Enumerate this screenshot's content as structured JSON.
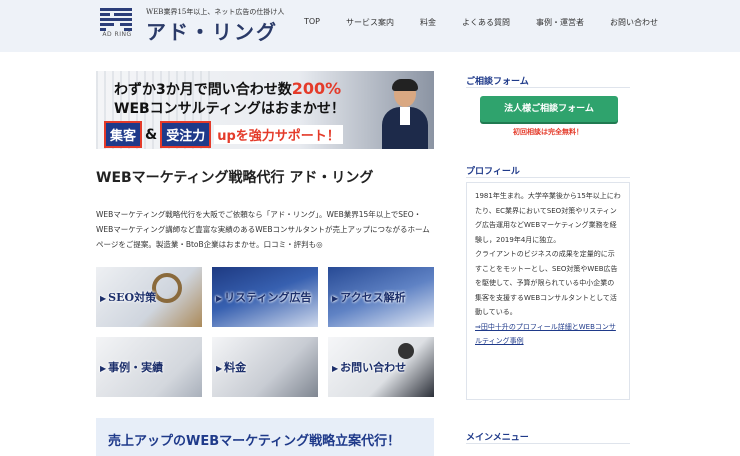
{
  "header": {
    "logo_caption": "AD RING",
    "tagline": "WEB業界15年以上、ネット広告の仕掛け人",
    "brand": "アド・リング",
    "nav": [
      "TOP",
      "サービス案内",
      "料金",
      "よくある質問",
      "事例・運営者",
      "お問い合わせ"
    ]
  },
  "hero": {
    "line1_pre": "わずか3か月で問い合わせ数",
    "line1_highlight": "200%",
    "line2": "WEBコンサルティングはおまかせ！",
    "tag1": "集客",
    "amp": "&",
    "tag2": "受注力",
    "tail": "upを強力サポート！"
  },
  "main": {
    "title": "WEBマーケティング戦略代行 アド・リング",
    "intro": "WEBマーケティング戦略代行を大阪でご依頼なら「アド・リング」。WEB業界15年以上でSEO・WEBマーケティング講師など豊富な実績のあるWEBコンサルタントが売上アップにつながるホームページをご提案。製造業・BtoB企業はおまかせ。口コミ・評判も◎",
    "tiles": [
      {
        "label": "SEO対策"
      },
      {
        "label": "リスティング広告"
      },
      {
        "label": "アクセス解析"
      },
      {
        "label": "事例・実績"
      },
      {
        "label": "料金"
      },
      {
        "label": "お問い合わせ"
      }
    ],
    "cta_band": "売上アップのWEBマーケティング戦略立案代行！"
  },
  "sidebar": {
    "consult_heading": "ご相談フォーム",
    "consult_button": "法人様ご相談フォーム",
    "consult_note": "初回相談は完全無料！",
    "profile_heading": "プロフィール",
    "profile_text_1": "1981年生まれ。大学卒業後から15年以上にわたり、EC業界においてSEO対策やリスティング広告運用などWEBマーケティング業務を経験し，2019年4月に独立。",
    "profile_text_2": "クライアントのビジネスの成果を定量的に示すことをモットーとし、SEO対策やWEB広告を駆使して、予算が限られている中小企業の集客を支援するWEBコンサルタントとして活動している。",
    "profile_link": "⇒田中十升のプロフィール詳細とWEBコンサルティング事例",
    "menu_heading": "メインメニュー"
  },
  "colors": {
    "brand_navy": "#1f3a8a",
    "accent_red": "#e43b2a",
    "button_green": "#2fa36d",
    "header_bg": "#eef2f8"
  }
}
